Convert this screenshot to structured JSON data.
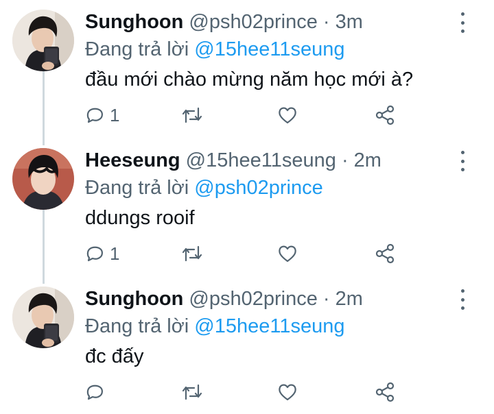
{
  "tweets": [
    {
      "display_name": "Sunghoon",
      "handle": "@psh02prince",
      "separator": "·",
      "time": "3m",
      "reply_prefix": "Đang trả lời",
      "reply_to": "@15hee11seung",
      "text": "đầu mới chào mừng năm học mới à?",
      "reply_count": "1",
      "avatar": "sunghoon-avatar"
    },
    {
      "display_name": "Heeseung",
      "handle": "@15hee11seung",
      "separator": "·",
      "time": "2m",
      "reply_prefix": "Đang trả lời",
      "reply_to": "@psh02prince",
      "text": "ddungs rooif",
      "reply_count": "1",
      "avatar": "heeseung-avatar"
    },
    {
      "display_name": "Sunghoon",
      "handle": "@psh02prince",
      "separator": "·",
      "time": "2m",
      "reply_prefix": "Đang trả lời",
      "reply_to": "@15hee11seung",
      "text": "đc đấy",
      "reply_count": "",
      "avatar": "sunghoon-avatar"
    }
  ],
  "icons": {
    "reply": "reply-icon",
    "retweet": "retweet-icon",
    "like": "heart-icon",
    "share": "share-icon",
    "more": "more-options-icon"
  },
  "colors": {
    "name": "#0f1419",
    "secondary": "#536471",
    "link": "#1d9bf0",
    "thread_line": "#cfd9de"
  }
}
